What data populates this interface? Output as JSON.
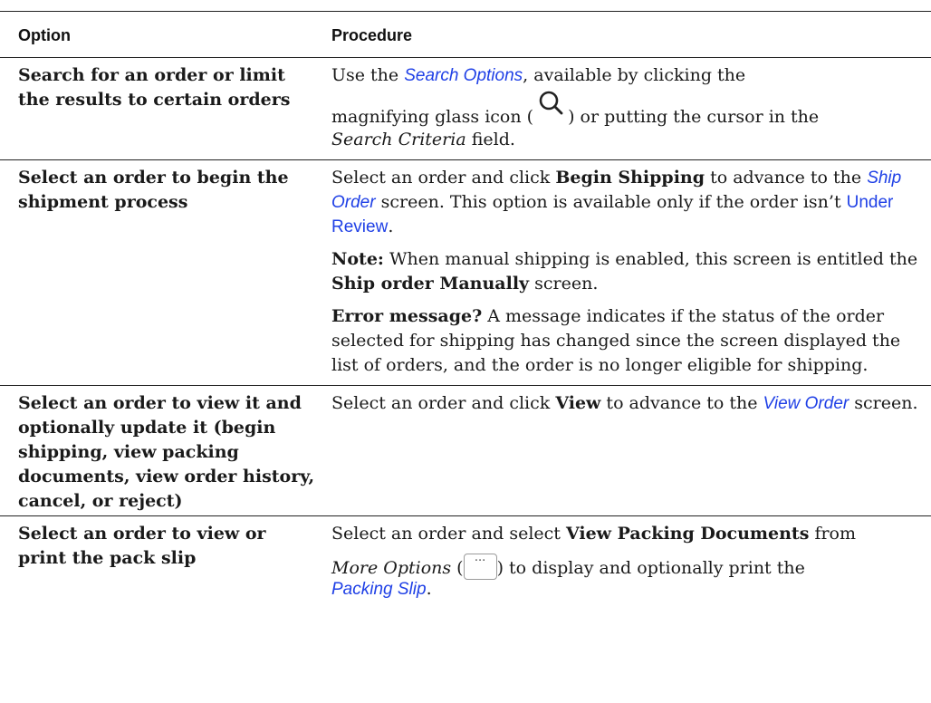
{
  "table": {
    "headers": {
      "option": "Option",
      "procedure": "Procedure"
    },
    "rows": [
      {
        "option": "Search for an order or limit the results to certain orders",
        "procedure": {
          "t1": "Use the ",
          "link1": "Search Options",
          "t2": ", available by clicking the",
          "t3": "magnifying glass icon (",
          "t4": ") or putting the cursor in the",
          "em1": "Search Criteria",
          "t5": " field.",
          "icon": "magnifying-glass-icon"
        }
      },
      {
        "option": "Select an order to begin the shipment process",
        "p1": {
          "t1": "Select an order and click ",
          "b1": "Begin Shipping",
          "t2": " to advance to the ",
          "link1": "Ship Order",
          "t3": " screen. This option is available only if the order isn’t ",
          "link2": "Under Review",
          "t4": "."
        },
        "p2": {
          "b1": "Note:",
          "t1": " When manual shipping is enabled, this screen is entitled the ",
          "b2": "Ship order Manually",
          "t2": " screen."
        },
        "p3": {
          "b1": "Error message?",
          "t1": " A message indicates if the status of the order selected for shipping has changed since the screen displayed the list of orders, and the order is no longer eligible for shipping."
        }
      },
      {
        "option": "Select an order to view it and optionally update it (begin shipping, view packing documents, view order history, cancel, or reject)",
        "procedure": {
          "t1": "Select an order and click ",
          "b1": "View",
          "t2": " to advance to the ",
          "link1": "View Order",
          "t3": " screen."
        }
      },
      {
        "option": "Select an order to view or print the pack slip",
        "procedure": {
          "t1": "Select an order and select ",
          "b1": "View Packing Documents",
          "t2": " from",
          "em1": "More Options",
          "t3": " (",
          "icon_text": "···",
          "t4": ") to display and optionally print the",
          "link1": "Packing Slip",
          "t5": ".",
          "icon": "more-options-icon"
        }
      }
    ]
  },
  "colors": {
    "link": "#1f40e6",
    "text": "#1a1a1a",
    "rule": "#222222"
  }
}
